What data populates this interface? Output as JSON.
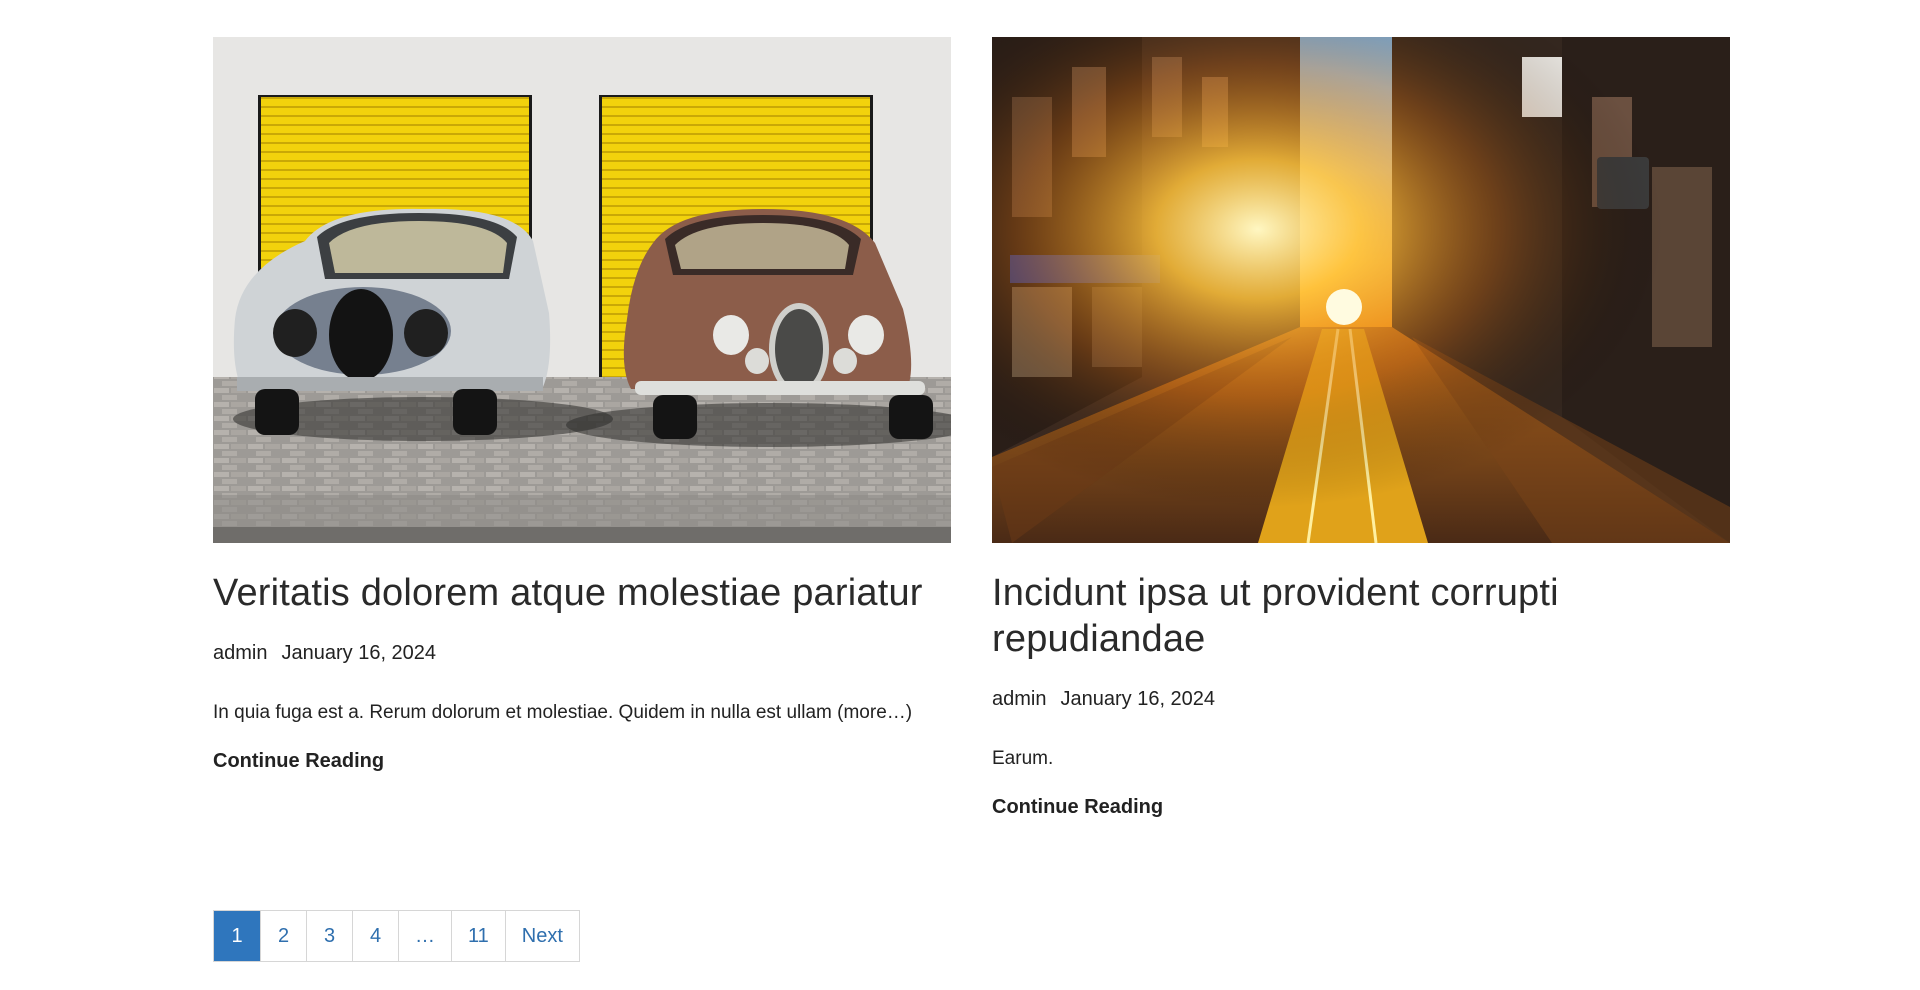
{
  "posts": [
    {
      "image_alt": "Two vintage cars parked in front of yellow garage doors",
      "title": "Veritatis dolorem atque molestiae pariatur",
      "author": "admin",
      "date": "January 16, 2024",
      "excerpt": "In quia fuga est a. Rerum dolorum et molestiae. Quidem in nulla est ullam (more…)",
      "continue_label": "Continue Reading"
    },
    {
      "image_alt": "City street at sunset with sunlight between buildings",
      "title": "Incidunt ipsa ut provident corrupti repudiandae",
      "author": "admin",
      "date": "January 16, 2024",
      "excerpt": "Earum.",
      "continue_label": "Continue Reading"
    }
  ],
  "pagination": {
    "pages": [
      "1",
      "2",
      "3",
      "4",
      "…",
      "11"
    ],
    "current": "1",
    "next_label": "Next"
  },
  "colors": {
    "accent": "#2f76bd",
    "link": "#2f6fae",
    "text": "#222222"
  }
}
